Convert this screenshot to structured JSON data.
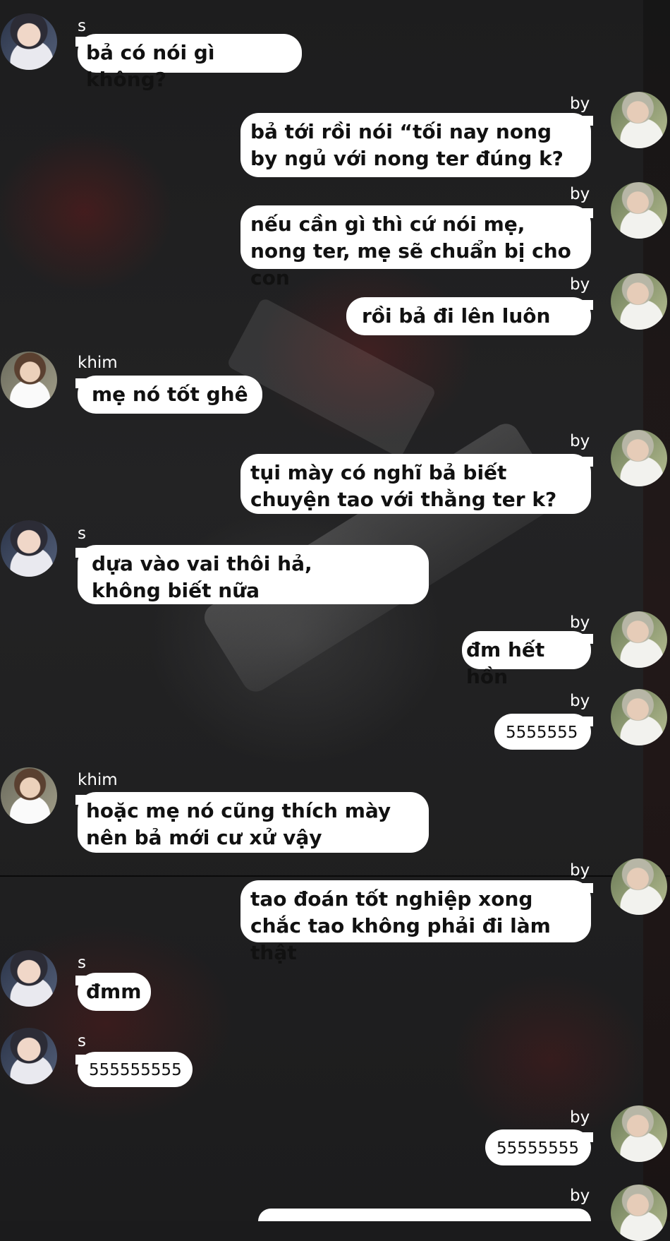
{
  "participants": {
    "s": {
      "name": "s",
      "avatar": "avatar-s"
    },
    "by": {
      "name": "by",
      "avatar": "avatar-by"
    },
    "khim": {
      "name": "khim",
      "avatar": "avatar-khim"
    }
  },
  "messages": [
    {
      "sender": "s",
      "text": "bả có nói gì không?"
    },
    {
      "sender": "by",
      "text": "bả tới rồi nói “tối nay nong by ngủ với nong ter đúng k?"
    },
    {
      "sender": "by",
      "text": "nếu cần gì thì cứ nói mẹ, nong ter, mẹ sẽ chuẩn bị cho con"
    },
    {
      "sender": "by",
      "text": "rồi bả đi lên luôn"
    },
    {
      "sender": "khim",
      "text": "mẹ nó tốt ghê"
    },
    {
      "sender": "by",
      "text": "tụi mày có nghĩ bả biết chuyện tao với thằng ter k?"
    },
    {
      "sender": "s",
      "text": "dựa vào vai thôi hả, không biết nữa"
    },
    {
      "sender": "by",
      "text": "đm hết hồn"
    },
    {
      "sender": "by",
      "text": "5555555"
    },
    {
      "sender": "khim",
      "text": "hoặc mẹ nó cũng thích mày nên bả mới cư xử vậy"
    },
    {
      "sender": "by",
      "text": "tao đoán tốt nghiệp xong chắc tao không phải đi làm thật"
    },
    {
      "sender": "s",
      "text": "đmm"
    },
    {
      "sender": "s",
      "text": "555555555"
    },
    {
      "sender": "by",
      "text": "55555555"
    },
    {
      "sender": "by",
      "text": ""
    }
  ]
}
